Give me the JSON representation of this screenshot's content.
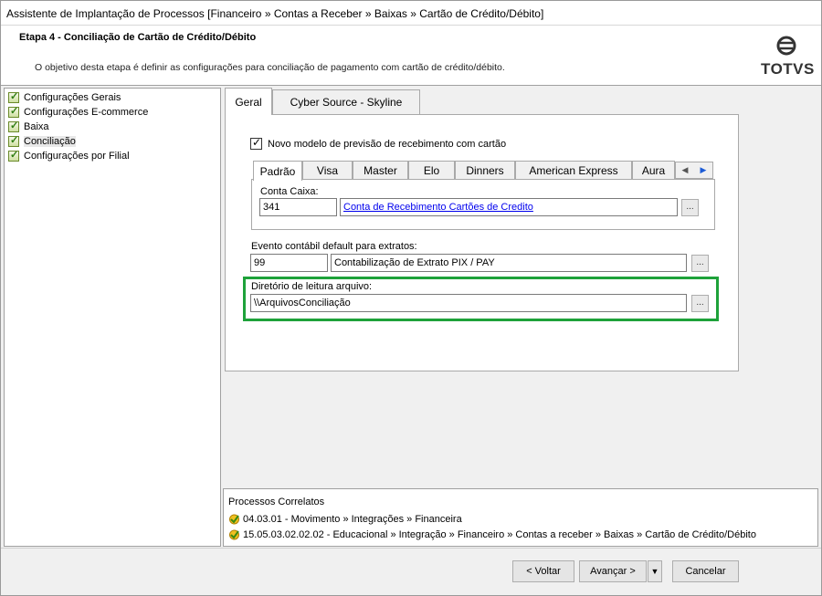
{
  "window": {
    "title": "Assistente de Implantação de Processos [Financeiro » Contas a Receber » Baixas » Cartão de Crédito/Débito]"
  },
  "header": {
    "step_title": "Etapa 4 - Conciliação de Cartão de Crédito/Débito",
    "step_description": "O objetivo desta etapa é definir as configurações para conciliação de pagamento com cartão de crédito/débito.",
    "logo_text": "TOTVS"
  },
  "sidebar": {
    "items": [
      {
        "label": "Configurações Gerais",
        "icon": "checked-doc-icon"
      },
      {
        "label": "Configurações E-commerce",
        "icon": "checked-doc-icon"
      },
      {
        "label": "Baixa",
        "icon": "checked-doc-icon"
      },
      {
        "label": "Conciliação",
        "icon": "checked-doc-icon",
        "selected": true
      },
      {
        "label": "Configurações por Filial",
        "icon": "checked-doc-icon"
      }
    ]
  },
  "main": {
    "tabs": [
      {
        "label": "Geral",
        "active": true
      },
      {
        "label": "Cyber Source - Skyline",
        "active": false
      }
    ],
    "novo_modelo": {
      "label": "Novo modelo de previsão de recebimento com cartão",
      "checked": true
    },
    "card_tabs": [
      {
        "label": "Padrão",
        "active": true
      },
      {
        "label": "Visa"
      },
      {
        "label": "Master"
      },
      {
        "label": "Elo"
      },
      {
        "label": "Dinners"
      },
      {
        "label": "American Express"
      },
      {
        "label": "Aura"
      }
    ],
    "conta_caixa": {
      "label": "Conta Caixa:",
      "code": "341",
      "description": "Conta de Recebimento Cartões de Credito"
    },
    "evento": {
      "label": "Evento contábil default para extratos:",
      "code": "99",
      "description": "Contabilização de Extrato PIX / PAY"
    },
    "diretorio": {
      "label": "Diretório de leitura arquivo:",
      "value": "\\\\ArquivosConciliação"
    },
    "lookup_label": "..."
  },
  "related": {
    "title": "Processos Correlatos",
    "items": [
      "04.03.01 - Movimento » Integrações » Financeira",
      "15.05.03.02.02.02 - Educacional » Integração » Financeiro » Contas a receber » Baixas » Cartão de Crédito/Débito"
    ]
  },
  "footer": {
    "back_label": "< Voltar",
    "next_label": "Avançar >",
    "dropdown_label": "▼",
    "cancel_label": "Cancelar"
  },
  "colors": {
    "highlight": "#1ea23a",
    "link": "#0000ee"
  }
}
